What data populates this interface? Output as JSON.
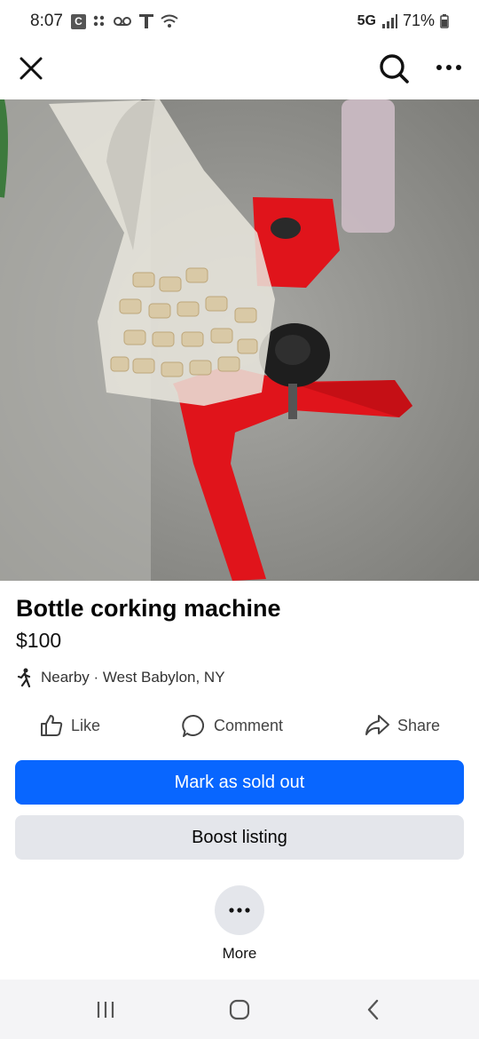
{
  "status_bar": {
    "time": "8:07",
    "network": "5G",
    "battery": "71%",
    "icons": [
      "c-notification-icon",
      "dots-icon",
      "voicemail-icon",
      "t-mobile-icon",
      "wifi-icon",
      "signal-icon",
      "battery-icon"
    ]
  },
  "top_bar": {
    "close_icon": "close-icon",
    "search_icon": "search-icon",
    "more_icon": "more-horizontal-icon"
  },
  "listing": {
    "title": "Bottle corking machine",
    "price": "$100",
    "location": "Nearby · West Babylon, NY"
  },
  "actions": {
    "like": "Like",
    "comment": "Comment",
    "share": "Share"
  },
  "buttons": {
    "mark_sold": "Mark as sold out",
    "boost": "Boost listing",
    "more": "More"
  },
  "colors": {
    "primary": "#0866ff",
    "secondary_bg": "#e4e6eb",
    "machine_red": "#e0141b"
  }
}
